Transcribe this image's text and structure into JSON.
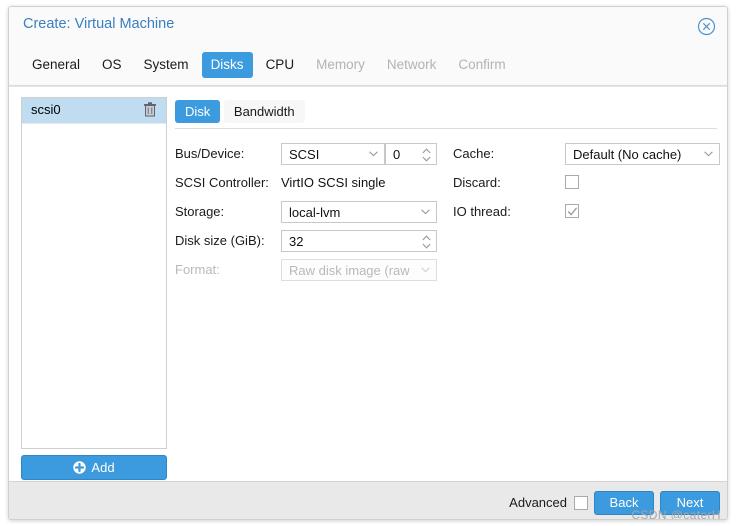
{
  "window": {
    "title": "Create: Virtual Machine",
    "close_icon": "close-circle-icon"
  },
  "tabs": [
    {
      "label": "General",
      "state": "enabled"
    },
    {
      "label": "OS",
      "state": "enabled"
    },
    {
      "label": "System",
      "state": "enabled"
    },
    {
      "label": "Disks",
      "state": "active"
    },
    {
      "label": "CPU",
      "state": "enabled"
    },
    {
      "label": "Memory",
      "state": "disabled"
    },
    {
      "label": "Network",
      "state": "disabled"
    },
    {
      "label": "Confirm",
      "state": "disabled"
    }
  ],
  "disk_list": {
    "items": [
      {
        "label": "scsi0",
        "delete_icon": "trash-icon"
      }
    ],
    "add_label": "Add",
    "add_icon": "plus-circle-icon"
  },
  "subtabs": [
    {
      "label": "Disk",
      "state": "active"
    },
    {
      "label": "Bandwidth",
      "state": "inactive"
    }
  ],
  "form": {
    "bus_device": {
      "label": "Bus/Device:",
      "bus_value": "SCSI",
      "device_value": "0"
    },
    "scsi_controller": {
      "label": "SCSI Controller:",
      "value": "VirtIO SCSI single"
    },
    "storage": {
      "label": "Storage:",
      "value": "local-lvm"
    },
    "disk_size": {
      "label": "Disk size (GiB):",
      "value": "32"
    },
    "format": {
      "label": "Format:",
      "value": "Raw disk image (raw"
    },
    "cache": {
      "label": "Cache:",
      "value": "Default (No cache)"
    },
    "discard": {
      "label": "Discard:",
      "checked": false
    },
    "io_thread": {
      "label": "IO thread:",
      "checked": true
    }
  },
  "footer": {
    "advanced_label": "Advanced",
    "advanced_checked": false,
    "back_label": "Back",
    "next_label": "Next"
  },
  "watermark": "CSDN @caterH",
  "colors": {
    "accent": "#3c9ade",
    "title_text": "#3a7fc1",
    "selected_row": "#bfdcf0",
    "footer_bg": "#e9e9e9",
    "disabled_text": "#b9b9b9"
  }
}
